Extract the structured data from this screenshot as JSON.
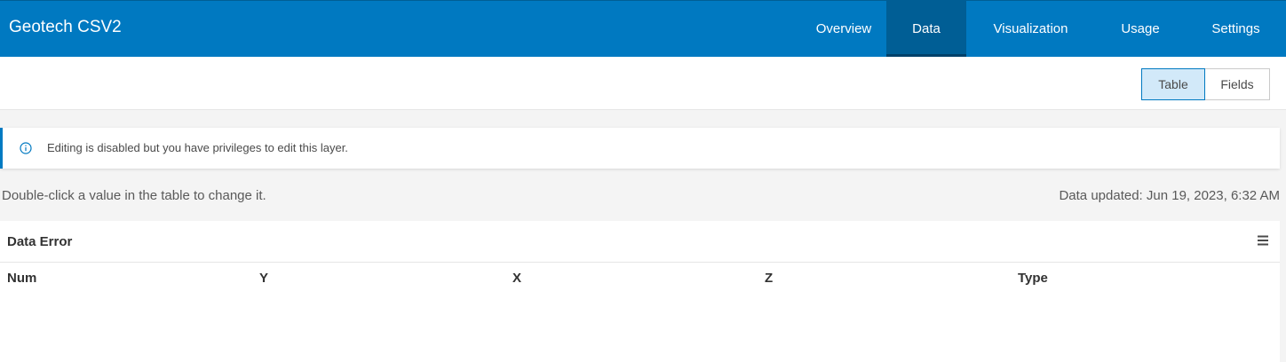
{
  "header": {
    "title": "Geotech CSV2",
    "tabs": [
      {
        "label": "Overview",
        "active": false
      },
      {
        "label": "Data",
        "active": true
      },
      {
        "label": "Visualization",
        "active": false
      },
      {
        "label": "Usage",
        "active": false
      },
      {
        "label": "Settings",
        "active": false
      }
    ]
  },
  "view_toggle": {
    "table_label": "Table",
    "fields_label": "Fields",
    "selected": "Table"
  },
  "notice": {
    "icon": "info-icon",
    "text": "Editing is disabled but you have privileges to edit this layer."
  },
  "hint": "Double-click a value in the table to change it.",
  "data_updated": "Data updated: Jun 19, 2023, 6:32 AM",
  "table": {
    "title": "Data Error",
    "menu_icon": "hamburger-menu-icon",
    "columns": [
      "Num",
      "Y",
      "X",
      "Z",
      "Type"
    ]
  },
  "colors": {
    "brand": "#0079c1",
    "brand_dark": "#005e95",
    "selected_toggle": "#d2e9f9",
    "notice_accent": "#007ac2"
  }
}
